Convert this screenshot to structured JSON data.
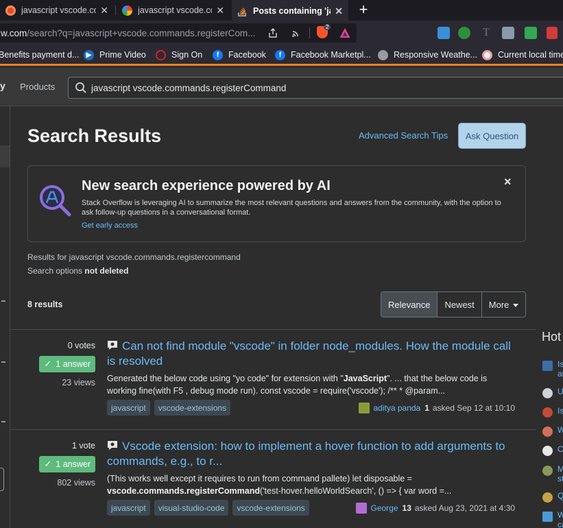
{
  "browser": {
    "tabs": [
      {
        "title": "javascript vscode.comma",
        "icon": "brave-icon",
        "active": false
      },
      {
        "title": "javascript vscode.comma",
        "icon": "google-icon",
        "active": false
      },
      {
        "title": "Posts containing 'ja",
        "icon": "stackoverflow-icon",
        "active": true
      }
    ],
    "new_tab": "+",
    "url_domain": "w.com",
    "url_path": "/search?q=javascript+vscode.commands.registerCom...",
    "shield_count": "2",
    "bookmarks": [
      {
        "label": "Benefits payment d...",
        "icon": "globe-icon"
      },
      {
        "label": "Prime Video",
        "icon": "play-icon"
      },
      {
        "label": "Sign On",
        "icon": "wellsfargo-icon"
      },
      {
        "label": "Facebook",
        "icon": "facebook-icon"
      },
      {
        "label": "Facebook Marketpl...",
        "icon": "facebook-icon"
      },
      {
        "label": "Responsive Weathe...",
        "icon": "globe-icon"
      },
      {
        "label": "Current local time",
        "icon": "clock-icon"
      }
    ]
  },
  "header": {
    "logo_fragment": "y",
    "products_label": "Products",
    "search_value": "javascript vscode.commands.registerCommand"
  },
  "main": {
    "title": "Search Results",
    "advanced_tips": "Advanced Search Tips",
    "ask_button": "Ask Question",
    "ai_banner": {
      "title": "New search experience powered by AI",
      "description": "Stack Overflow is leveraging AI to summarize the most relevant questions and answers from the community, with the option to ask follow-up questions in a conversational format.",
      "cta": "Get early access",
      "close": "×"
    },
    "results_for": "Results for javascript vscode.commands.registercommand",
    "search_options_prefix": "Search options",
    "search_options_value": "not deleted",
    "results_count": "8 results",
    "sort_options": [
      "Relevance",
      "Newest",
      "More"
    ],
    "sort_selected": "Relevance"
  },
  "results": [
    {
      "votes": "0 votes",
      "answers": "1 answer",
      "views": "23 views",
      "title": "Can not find module \"vscode\" in folder node_modules. How the module call is resolved",
      "excerpt_pre": "Generated the below code using \"yo code\" for extension with \"",
      "excerpt_bold": "JavaScript",
      "excerpt_post": "\". ... that the below code is working fine(with F5 , debug mode run). const vscode = require('vscode'); /** * @param...",
      "tags": [
        "javascript",
        "vscode-extensions"
      ],
      "user": "aditya panda",
      "reputation": "1",
      "asked": "asked Sep 12 at 10:10",
      "avatar_color": "#8a9a3a"
    },
    {
      "votes": "1 vote",
      "answers": "1 answer",
      "views": "802 views",
      "title": "Vscode extension: how to implement a hover function to add arguments to commands, e.g., to r...",
      "excerpt_pre": "(This works well except it requires to run from command pallete) let disposable = ",
      "excerpt_bold": "vscode.commands.registerCommand",
      "excerpt_post": "('test-hover.helloWorldSearch', () => { var word =...",
      "tags": [
        "javascript",
        "visual-studio-code",
        "vscode-extensions"
      ],
      "user": "George",
      "reputation": "13",
      "asked": "asked Aug 23, 2021 at 4:30",
      "avatar_color": "#b06fd0"
    }
  ],
  "sidebar": {
    "hot_title": "Hot",
    "hot_items": [
      {
        "text": "Is",
        "text2": "ai",
        "icon": "stackexchange-icon",
        "color": "#3b6ea8"
      },
      {
        "text": "U",
        "text2": "",
        "icon": "mathoverflow-icon",
        "color": "#cfd2d6"
      },
      {
        "text": "Is",
        "text2": "",
        "icon": "rpg-icon",
        "color": "#c24a3a"
      },
      {
        "text": "W",
        "text2": "",
        "icon": "pets-icon",
        "color": "#d0705c"
      },
      {
        "text": "C",
        "text2": "",
        "icon": "physics-icon",
        "color": "#e8e8e8"
      },
      {
        "text": "M",
        "text2": "st",
        "icon": "world-icon",
        "color": "#8a9a5a"
      },
      {
        "text": "Q",
        "text2": "",
        "icon": "gold-icon",
        "color": "#c8a04a"
      },
      {
        "text": "W",
        "text2": "ca",
        "icon": "superuser-icon",
        "color": "#4a9ad8"
      }
    ]
  },
  "colors": {
    "accent_orange": "#f48225",
    "link_blue": "#6cbbf7",
    "answer_green": "#5eba7d",
    "ask_button_bg": "#b3d3ea"
  }
}
